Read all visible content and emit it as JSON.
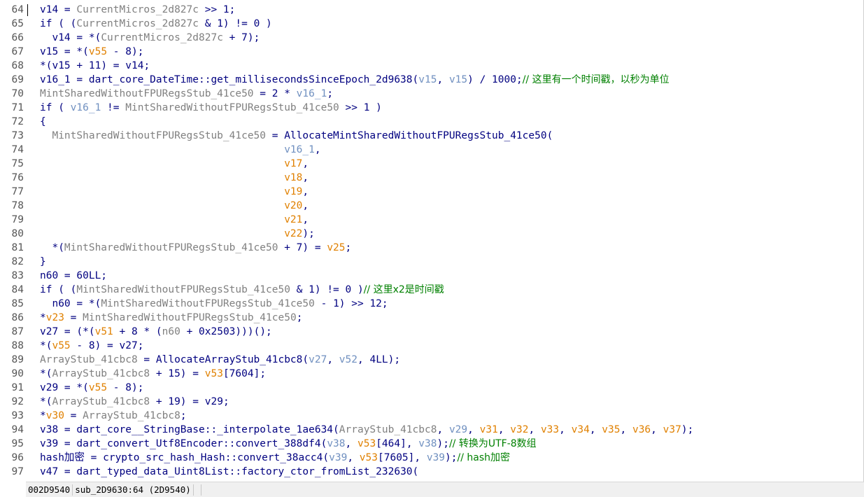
{
  "gutter": {
    "line_numbers": [
      "64",
      "65",
      "66",
      "67",
      "68",
      "69",
      "70",
      "71",
      "72",
      "73",
      "74",
      "75",
      "76",
      "77",
      "78",
      "79",
      "80",
      "81",
      "82",
      "83",
      "84",
      "85",
      "86",
      "87",
      "88",
      "89",
      "90",
      "91",
      "92",
      "93",
      "94",
      "95",
      "96",
      "97"
    ]
  },
  "code": {
    "lines": [
      [
        [
          "ident",
          "v14"
        ],
        [
          "op",
          " = "
        ],
        [
          "lgray",
          "CurrentMicros_2d827c"
        ],
        [
          "op",
          " >> 1;"
        ]
      ],
      [
        [
          "ident",
          "if ( ("
        ],
        [
          "lgray",
          "CurrentMicros_2d827c"
        ],
        [
          "op",
          " & 1) != 0 )"
        ]
      ],
      [
        [
          "op",
          "  "
        ],
        [
          "ident",
          "v14"
        ],
        [
          "op",
          " = *("
        ],
        [
          "lgray",
          "CurrentMicros_2d827c"
        ],
        [
          "op",
          " + 7);"
        ]
      ],
      [
        [
          "ident",
          "v15"
        ],
        [
          "op",
          " = *("
        ],
        [
          "orange",
          "v55"
        ],
        [
          "op",
          " - 8);"
        ]
      ],
      [
        [
          "op",
          "*("
        ],
        [
          "ident",
          "v15"
        ],
        [
          "op",
          " + 11) = "
        ],
        [
          "ident",
          "v14"
        ],
        [
          "op",
          ";"
        ]
      ],
      [
        [
          "ident",
          "v16_1"
        ],
        [
          "op",
          " = dart_core_DateTime::get_millisecondsSinceEpoch_2d9638("
        ],
        [
          "local",
          "v15"
        ],
        [
          "op",
          ", "
        ],
        [
          "local",
          "v15"
        ],
        [
          "op",
          ") / 1000;"
        ],
        [
          "cmt",
          "// 这里有一个时间戳，以秒为单位"
        ]
      ],
      [
        [
          "lgray",
          "MintSharedWithoutFPURegsStub_41ce50"
        ],
        [
          "op",
          " = 2 * "
        ],
        [
          "local",
          "v16_1"
        ],
        [
          "op",
          ";"
        ]
      ],
      [
        [
          "ident",
          "if ( "
        ],
        [
          "local",
          "v16_1"
        ],
        [
          "op",
          " != "
        ],
        [
          "lgray",
          "MintSharedWithoutFPURegsStub_41ce50"
        ],
        [
          "op",
          " >> 1 )"
        ]
      ],
      [
        [
          "op",
          "{"
        ]
      ],
      [
        [
          "op",
          "  "
        ],
        [
          "lgray",
          "MintSharedWithoutFPURegsStub_41ce50"
        ],
        [
          "op",
          " = AllocateMintSharedWithoutFPURegsStub_41ce50("
        ]
      ],
      [
        [
          "op",
          "                                        "
        ],
        [
          "local",
          "v16_1"
        ],
        [
          "op",
          ","
        ]
      ],
      [
        [
          "op",
          "                                        "
        ],
        [
          "orange",
          "v17"
        ],
        [
          "op",
          ","
        ]
      ],
      [
        [
          "op",
          "                                        "
        ],
        [
          "orange",
          "v18"
        ],
        [
          "op",
          ","
        ]
      ],
      [
        [
          "op",
          "                                        "
        ],
        [
          "orange",
          "v19"
        ],
        [
          "op",
          ","
        ]
      ],
      [
        [
          "op",
          "                                        "
        ],
        [
          "orange",
          "v20"
        ],
        [
          "op",
          ","
        ]
      ],
      [
        [
          "op",
          "                                        "
        ],
        [
          "orange",
          "v21"
        ],
        [
          "op",
          ","
        ]
      ],
      [
        [
          "op",
          "                                        "
        ],
        [
          "orange",
          "v22"
        ],
        [
          "op",
          ");"
        ]
      ],
      [
        [
          "op",
          "  *("
        ],
        [
          "lgray",
          "MintSharedWithoutFPURegsStub_41ce50"
        ],
        [
          "op",
          " + 7) = "
        ],
        [
          "orange",
          "v25"
        ],
        [
          "op",
          ";"
        ]
      ],
      [
        [
          "op",
          "}"
        ]
      ],
      [
        [
          "ident",
          "n60"
        ],
        [
          "op",
          " = 60LL;"
        ]
      ],
      [
        [
          "ident",
          "if ( ("
        ],
        [
          "lgray",
          "MintSharedWithoutFPURegsStub_41ce50"
        ],
        [
          "op",
          " & 1) != 0 )"
        ],
        [
          "cmt",
          "// 这里x2是时间戳"
        ]
      ],
      [
        [
          "op",
          "  "
        ],
        [
          "ident",
          "n60"
        ],
        [
          "op",
          " = *("
        ],
        [
          "lgray",
          "MintSharedWithoutFPURegsStub_41ce50"
        ],
        [
          "op",
          " - 1) >> 12;"
        ]
      ],
      [
        [
          "op",
          "*"
        ],
        [
          "orange",
          "v23"
        ],
        [
          "op",
          " = "
        ],
        [
          "lgray",
          "MintSharedWithoutFPURegsStub_41ce50"
        ],
        [
          "op",
          ";"
        ]
      ],
      [
        [
          "ident",
          "v27"
        ],
        [
          "op",
          " = (*("
        ],
        [
          "orange",
          "v51"
        ],
        [
          "op",
          " + 8 * ("
        ],
        [
          "lgray",
          "n60"
        ],
        [
          "op",
          " + 0x2503)))();"
        ]
      ],
      [
        [
          "op",
          "*("
        ],
        [
          "orange",
          "v55"
        ],
        [
          "op",
          " - 8) = "
        ],
        [
          "ident",
          "v27"
        ],
        [
          "op",
          ";"
        ]
      ],
      [
        [
          "lgray",
          "ArrayStub_41cbc8"
        ],
        [
          "op",
          " = AllocateArrayStub_41cbc8("
        ],
        [
          "local",
          "v27"
        ],
        [
          "op",
          ", "
        ],
        [
          "local",
          "v52"
        ],
        [
          "op",
          ", 4LL);"
        ]
      ],
      [
        [
          "op",
          "*("
        ],
        [
          "lgray",
          "ArrayStub_41cbc8"
        ],
        [
          "op",
          " + 15) = "
        ],
        [
          "orange",
          "v53"
        ],
        [
          "op",
          "[7604];"
        ]
      ],
      [
        [
          "ident",
          "v29"
        ],
        [
          "op",
          " = *("
        ],
        [
          "orange",
          "v55"
        ],
        [
          "op",
          " - 8);"
        ]
      ],
      [
        [
          "op",
          "*("
        ],
        [
          "lgray",
          "ArrayStub_41cbc8"
        ],
        [
          "op",
          " + 19) = "
        ],
        [
          "ident",
          "v29"
        ],
        [
          "op",
          ";"
        ]
      ],
      [
        [
          "op",
          "*"
        ],
        [
          "orange",
          "v30"
        ],
        [
          "op",
          " = "
        ],
        [
          "lgray",
          "ArrayStub_41cbc8"
        ],
        [
          "op",
          ";"
        ]
      ],
      [
        [
          "ident",
          "v38"
        ],
        [
          "op",
          " = dart_core__StringBase::_interpolate_1ae634("
        ],
        [
          "lgray",
          "ArrayStub_41cbc8"
        ],
        [
          "op",
          ", "
        ],
        [
          "local",
          "v29"
        ],
        [
          "op",
          ", "
        ],
        [
          "orange",
          "v31"
        ],
        [
          "op",
          ", "
        ],
        [
          "orange",
          "v32"
        ],
        [
          "op",
          ", "
        ],
        [
          "orange",
          "v33"
        ],
        [
          "op",
          ", "
        ],
        [
          "orange",
          "v34"
        ],
        [
          "op",
          ", "
        ],
        [
          "orange",
          "v35"
        ],
        [
          "op",
          ", "
        ],
        [
          "orange",
          "v36"
        ],
        [
          "op",
          ", "
        ],
        [
          "orange",
          "v37"
        ],
        [
          "op",
          ");"
        ]
      ],
      [
        [
          "ident",
          "v39"
        ],
        [
          "op",
          " = dart_convert_Utf8Encoder::convert_388df4("
        ],
        [
          "local",
          "v38"
        ],
        [
          "op",
          ", "
        ],
        [
          "orange",
          "v53"
        ],
        [
          "op",
          "[464], "
        ],
        [
          "local",
          "v38"
        ],
        [
          "op",
          ");"
        ],
        [
          "cmt",
          "// 转换为UTF-8数组"
        ]
      ],
      [
        [
          "ident",
          "hash加密"
        ],
        [
          "op",
          " = crypto_src_hash_Hash::convert_38acc4("
        ],
        [
          "local",
          "v39"
        ],
        [
          "op",
          ", "
        ],
        [
          "orange",
          "v53"
        ],
        [
          "op",
          "[7605], "
        ],
        [
          "local",
          "v39"
        ],
        [
          "op",
          ");"
        ],
        [
          "cmt",
          "// hash加密"
        ]
      ],
      [
        [
          "ident",
          "v47"
        ],
        [
          "op",
          " = dart_typed_data_Uint8List::factory_ctor_fromList_232630("
        ]
      ]
    ]
  },
  "status": {
    "address": "002D9540",
    "location": "sub_2D9630:64 (2D9540)"
  }
}
